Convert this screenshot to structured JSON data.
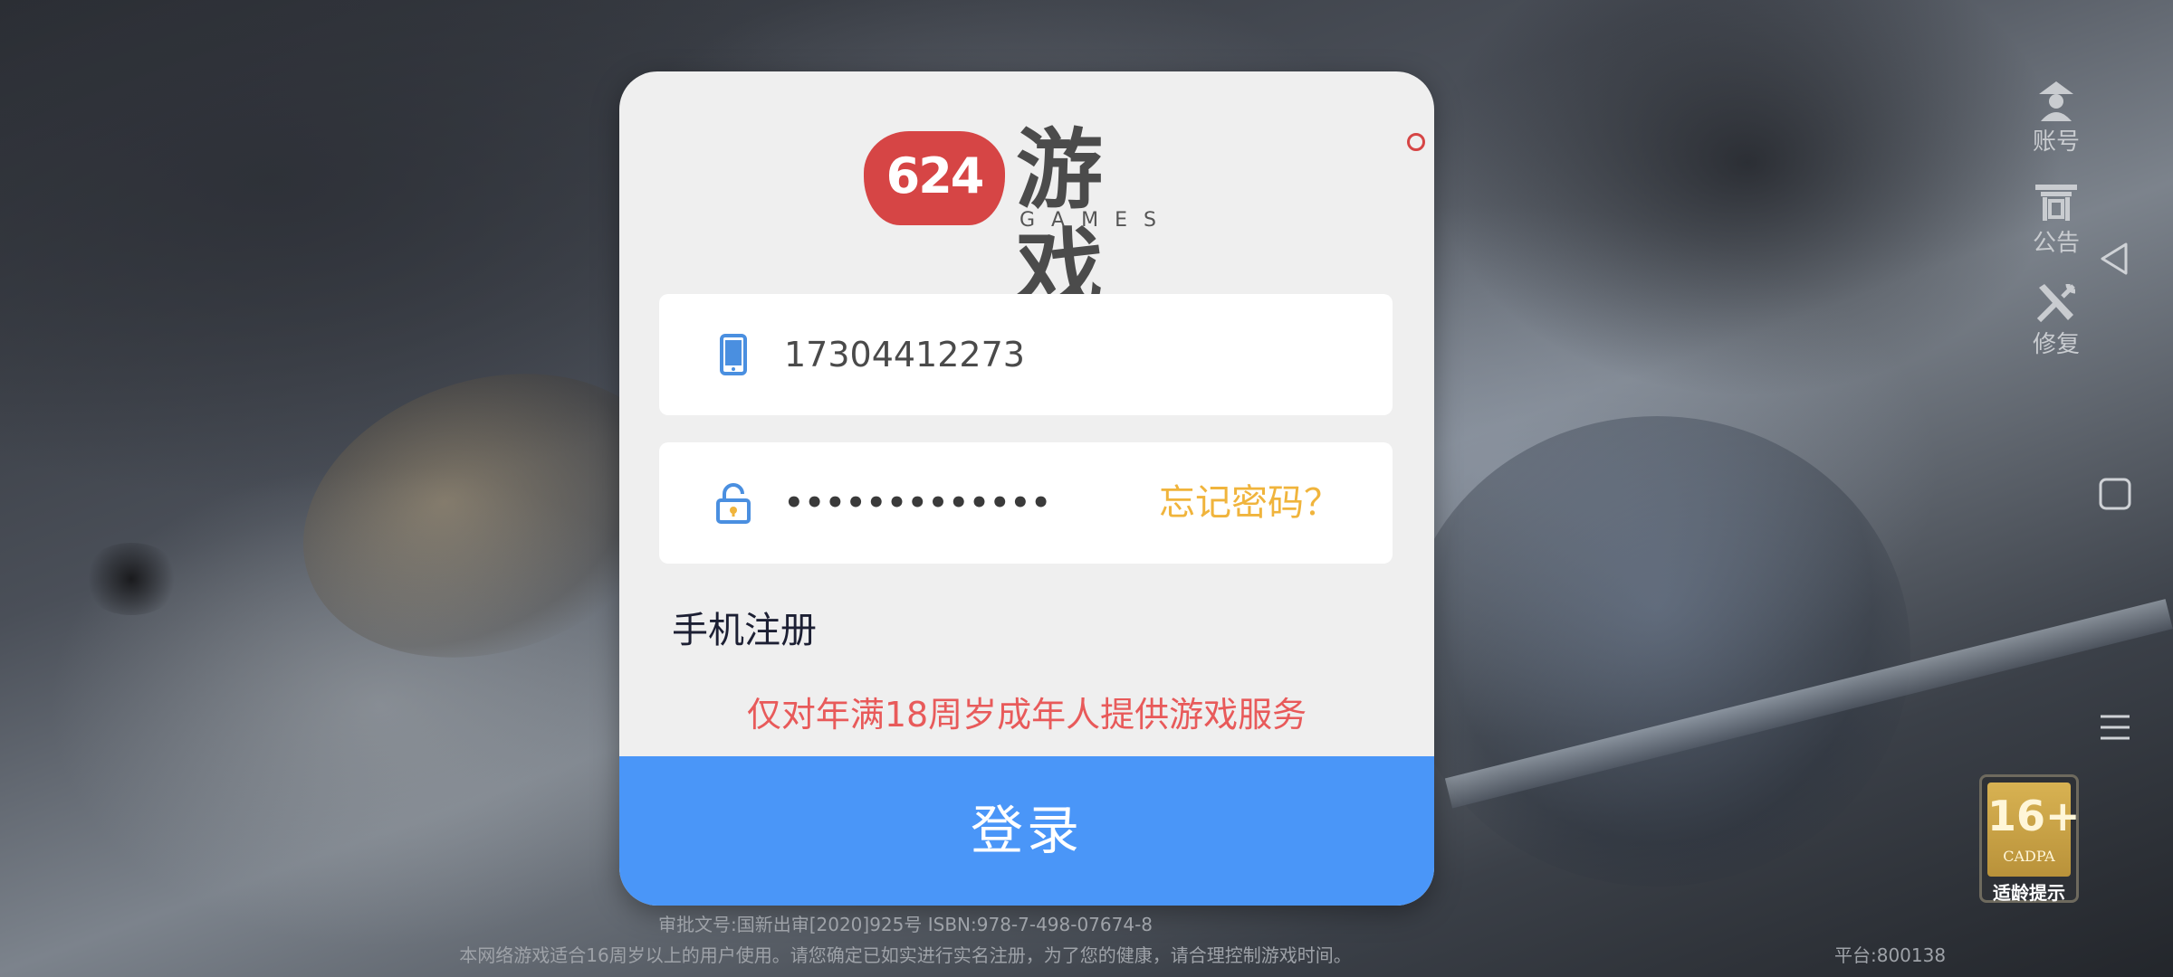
{
  "logo": {
    "badge": "624",
    "name": "游戏",
    "sub": "GAMES"
  },
  "login": {
    "phone_value": "17304412273",
    "password_value": "•••••••••••••",
    "forgot_label": "忘记密码？",
    "register_label": "手机注册",
    "age_notice": "仅对年满18周岁成年人提供游戏服务",
    "login_button": "登录"
  },
  "side_menu": [
    {
      "label": "账号",
      "icon": "account-icon"
    },
    {
      "label": "公告",
      "icon": "announcement-icon"
    },
    {
      "label": "修复",
      "icon": "repair-icon"
    }
  ],
  "rating": {
    "age": "16+",
    "org": "CADPA",
    "label": "适龄提示"
  },
  "footer": {
    "approval": "审批文号:国新出审[2020]925号  ISBN:978-7-498-07674-8",
    "notice": "本网络游戏适合16周岁以上的用户使用。请您确定已如实进行实名注册，为了您的健康，请合理控制游戏时间。",
    "platform": "平台:800138"
  },
  "colors": {
    "login_button": "#4a96f8",
    "forgot": "#f0b43c",
    "age_notice": "#e85a5a",
    "logo_red": "#d64545"
  }
}
